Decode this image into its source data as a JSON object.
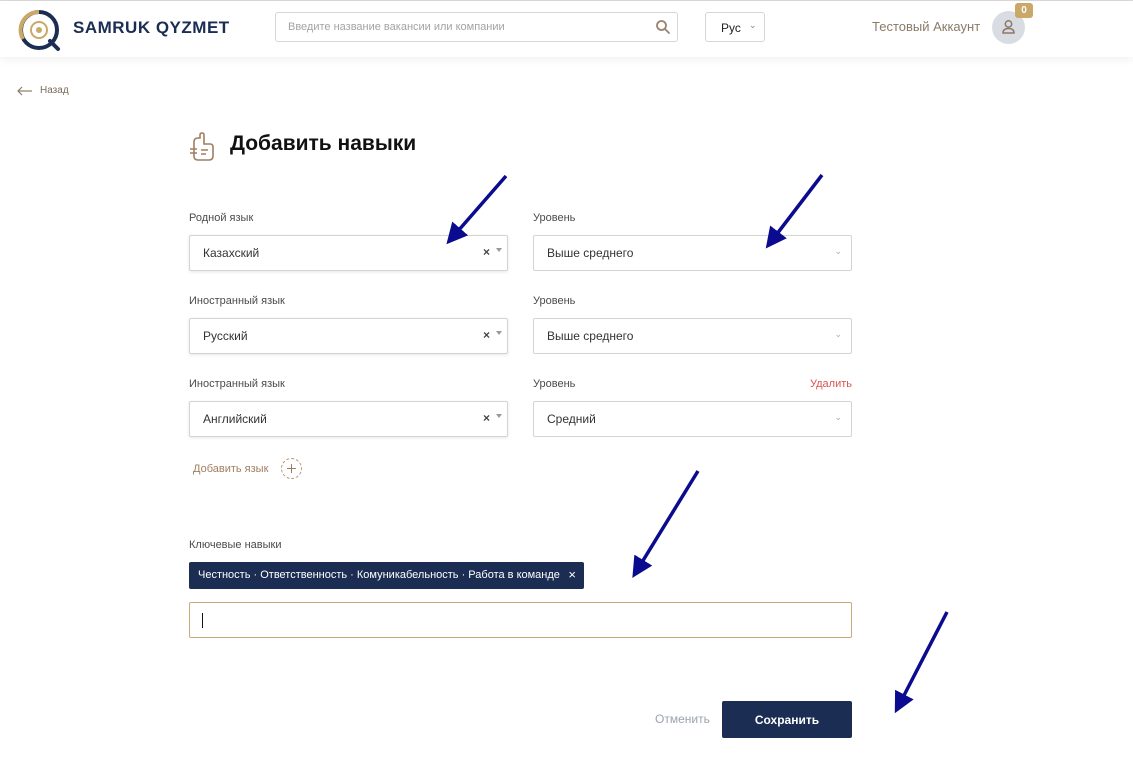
{
  "header": {
    "brand": "SAMRUK QYZMET",
    "search_placeholder": "Введите название вакансии или компании",
    "language": "Рус",
    "account_name": "Тестовый Аккаунт",
    "notification_count": "0"
  },
  "back_label": "Назад",
  "page_title": "Добавить навыки",
  "languages": [
    {
      "label": "Родной язык",
      "value": "Казахский",
      "level_label": "Уровень",
      "level": "Выше среднего"
    },
    {
      "label": "Иностранный язык",
      "value": "Русский",
      "level_label": "Уровень",
      "level": "Выше среднего"
    },
    {
      "label": "Иностранный язык",
      "value": "Английский",
      "level_label": "Уровень",
      "level": "Средний",
      "delete_label": "Удалить"
    }
  ],
  "add_language_label": "Добавить язык",
  "key_skills": {
    "label": "Ключевые навыки",
    "tag": "Честность · Ответственность · Комуникабельность · Работа в команде",
    "input_value": ""
  },
  "actions": {
    "cancel": "Отменить",
    "save": "Сохранить"
  },
  "icons": {
    "logo": "samruk-logo-icon",
    "search": "search-icon",
    "chevron": "chevron-down-icon",
    "avatar": "user-icon",
    "back": "arrow-left-icon",
    "title": "skills-icon",
    "clear": "clear-icon",
    "add": "plus-circle-icon",
    "annotation": "annotation-arrow-icon"
  },
  "colors": {
    "brand_navy": "#1b2d52",
    "accent_gold": "#c9a868",
    "delete_red": "#d9534f",
    "annotation_arrow": "#0b0b8f"
  }
}
